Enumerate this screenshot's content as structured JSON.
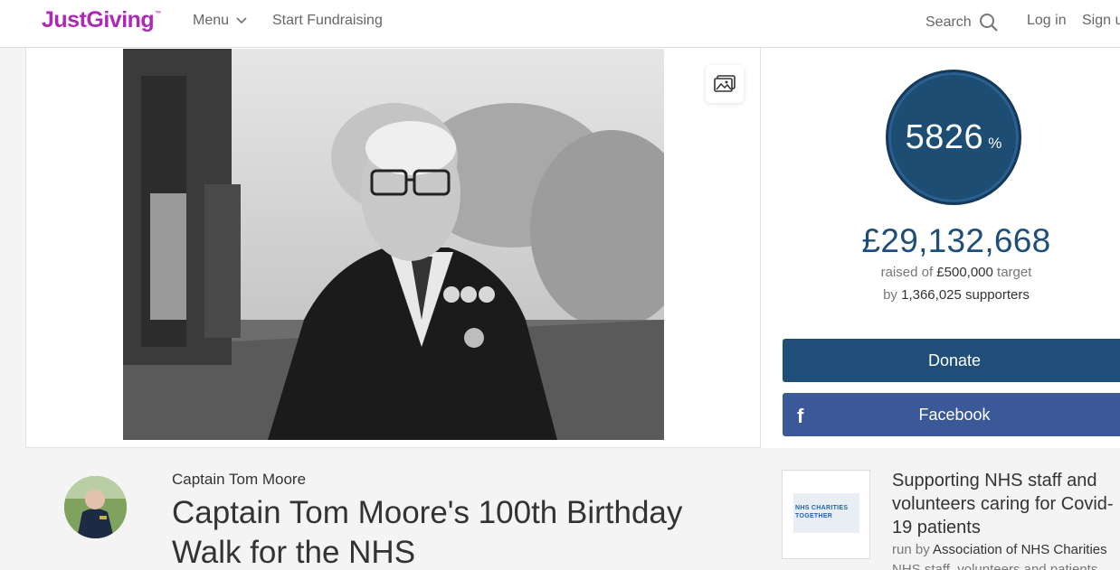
{
  "header": {
    "logo": "JustGiving",
    "logo_tm": "™",
    "menu_label": "Menu",
    "start_fundraising": "Start Fundraising",
    "search_label": "Search",
    "login": "Log in",
    "signup": "Sign up"
  },
  "hero": {
    "gallery_button_icon": "image-gallery-icon"
  },
  "stats": {
    "percent": "5826",
    "percent_symbol": "%",
    "total": "£29,132,668",
    "raised_prefix": "raised of",
    "target": "£500,000",
    "raised_suffix": "target",
    "by_prefix": "by",
    "supporters": "1,366,025 supporters"
  },
  "actions": {
    "donate": "Donate",
    "facebook": "Facebook",
    "facebook_icon": "f"
  },
  "fundraiser": {
    "owner": "Captain Tom Moore",
    "title": "Captain Tom Moore's 100th Birthday Walk for the NHS"
  },
  "charity": {
    "logo_text": "NHS CHARITIES TOGETHER",
    "cause": "Supporting NHS staff and volunteers caring for Covid-19 patients",
    "run_by_prefix": "run by",
    "run_by_name": "Association of NHS Charities",
    "description": "NHS staff, volunteers and patients"
  },
  "colors": {
    "brand": "#ad29b6",
    "primary": "#1f4e79",
    "facebook": "#3b5998"
  }
}
